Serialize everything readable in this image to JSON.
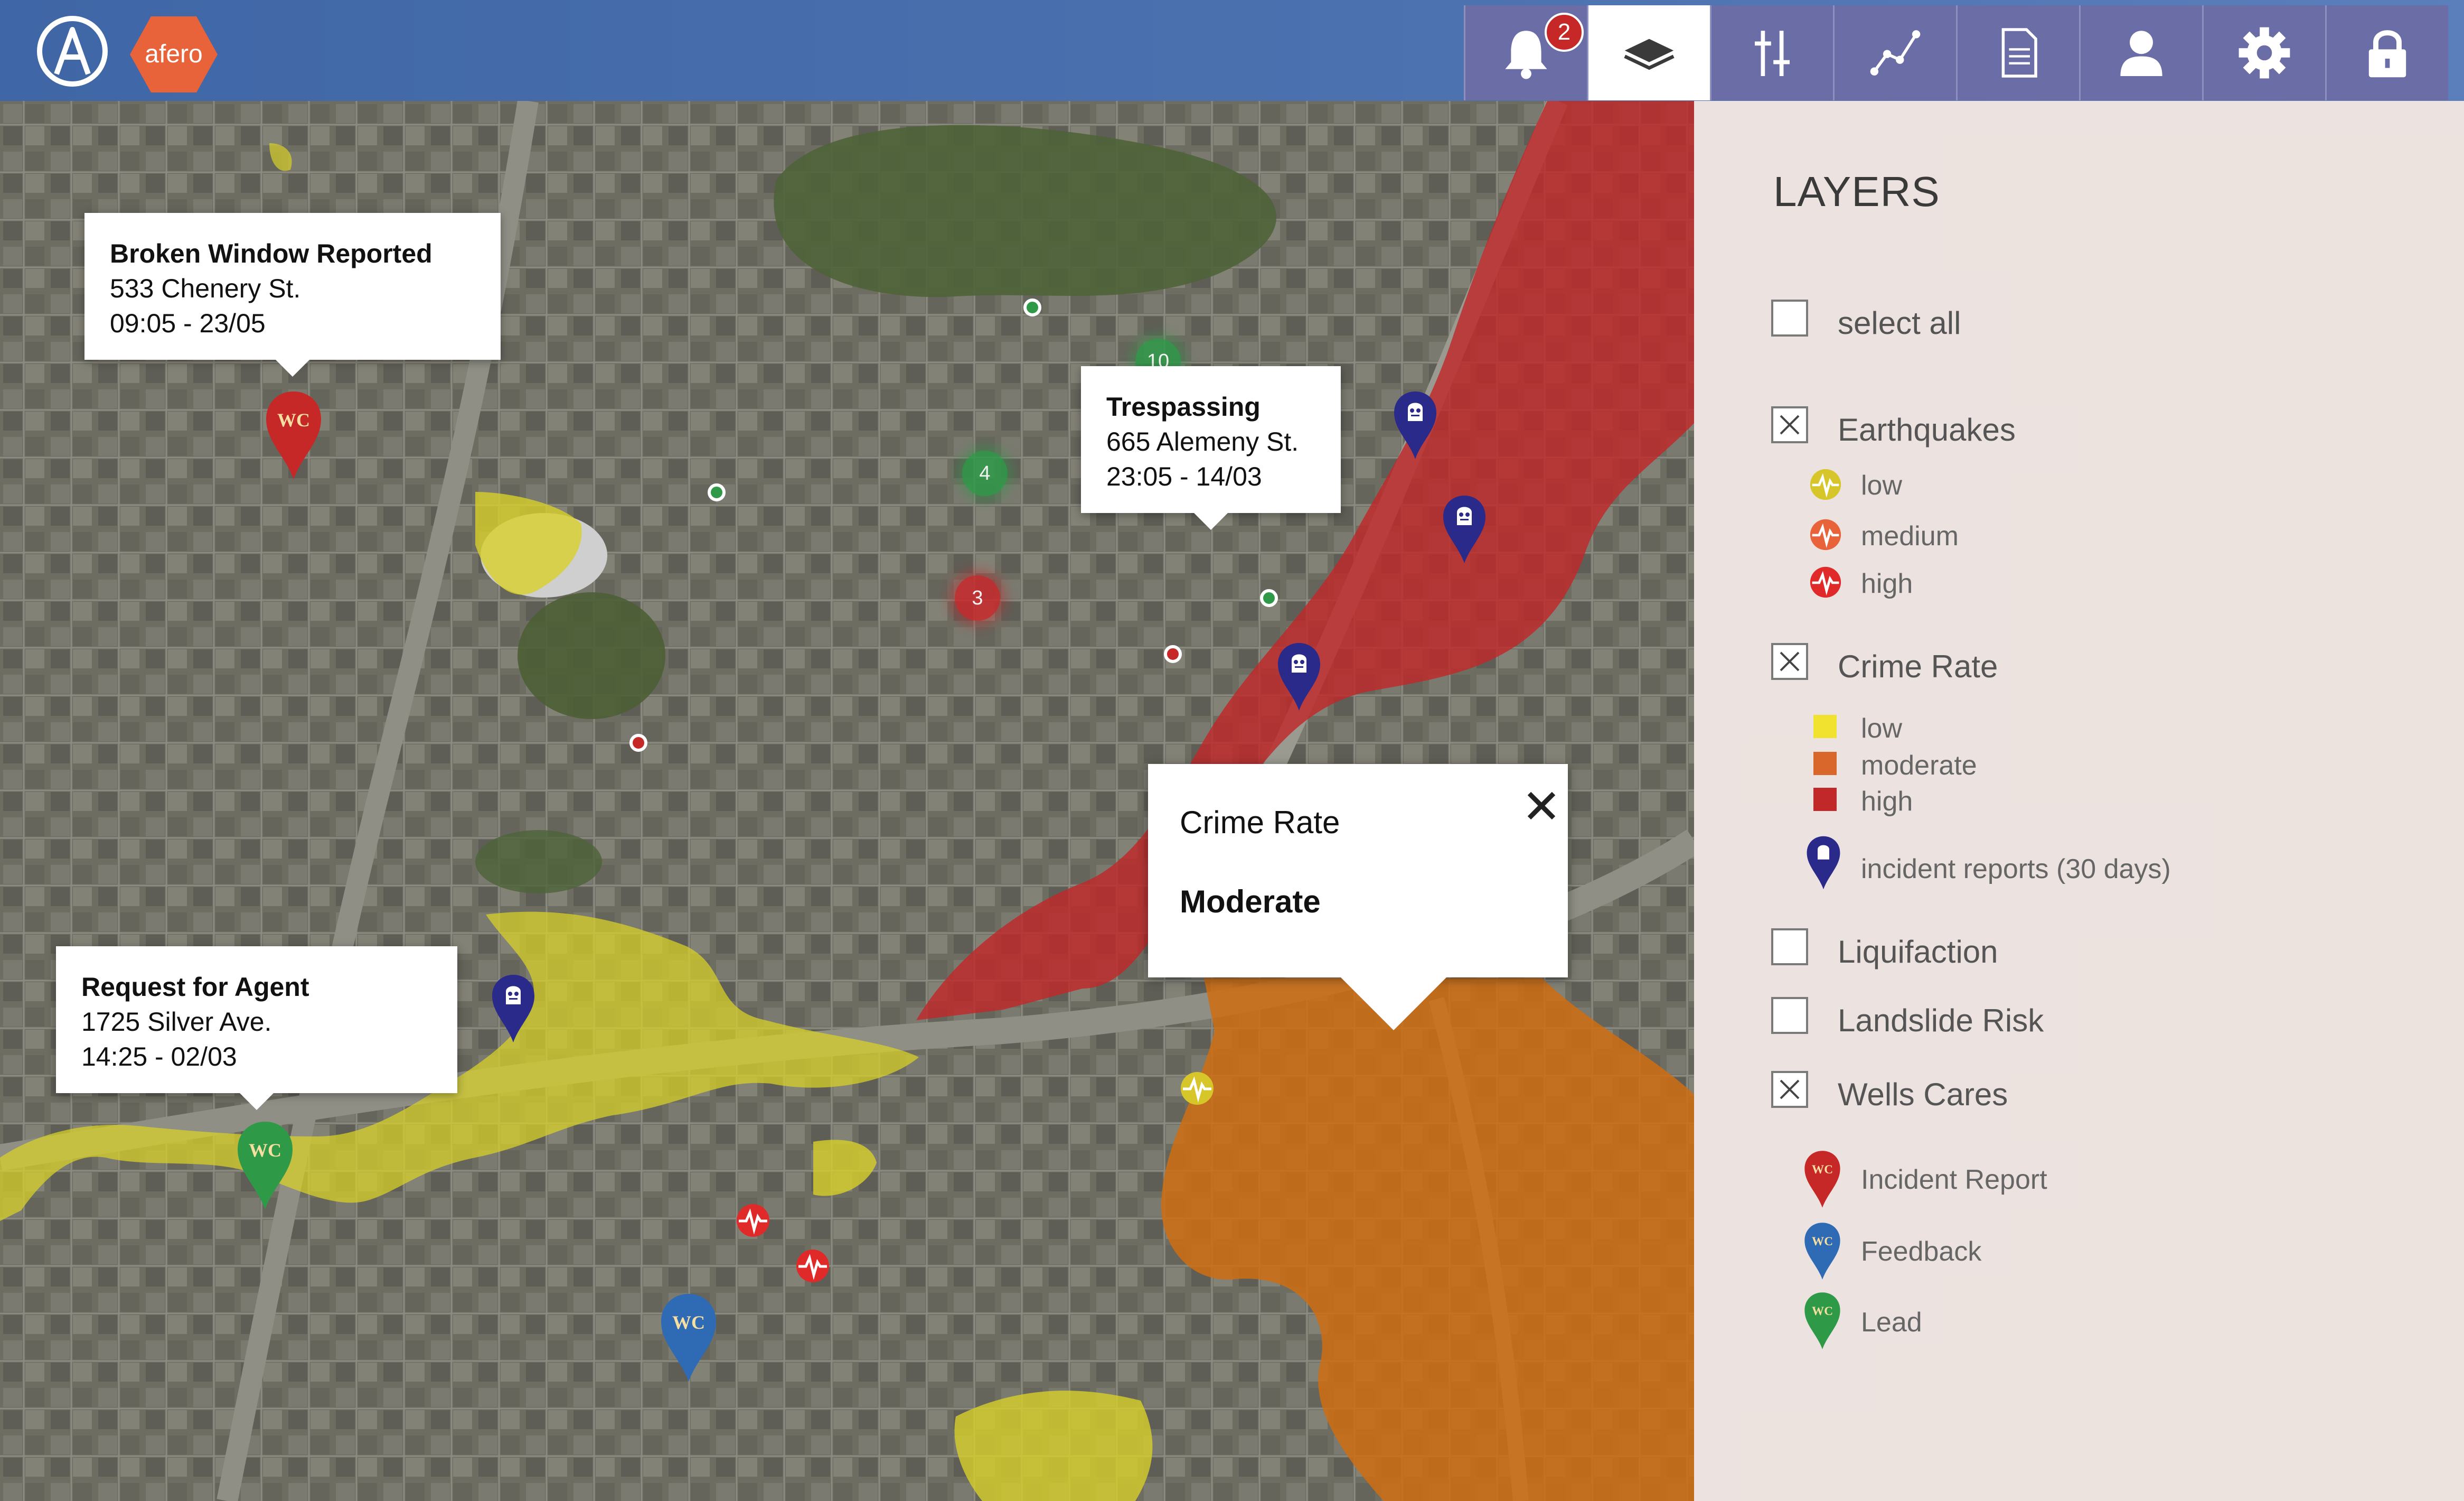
{
  "app": {
    "brand": "afero",
    "brand_color": "#e8623a",
    "header_color": "#4a6fae",
    "toolbar_color": "#6b6da6",
    "notification_count": "2"
  },
  "toolbar": [
    {
      "icon": "bell-icon",
      "active": false
    },
    {
      "icon": "layers-icon",
      "active": true
    },
    {
      "icon": "sliders-icon",
      "active": false
    },
    {
      "icon": "line-chart-icon",
      "active": false
    },
    {
      "icon": "document-icon",
      "active": false
    },
    {
      "icon": "user-icon",
      "active": false
    },
    {
      "icon": "gear-icon",
      "active": false
    },
    {
      "icon": "lock-icon",
      "active": false
    }
  ],
  "callouts": {
    "broken_window": {
      "title": "Broken Window Reported",
      "address": "533 Chenery St.",
      "time": "09:05 - 23/05"
    },
    "trespassing": {
      "title": "Trespassing",
      "address": "665 Alemeny St.",
      "time": "23:05 - 14/03"
    },
    "request_agent": {
      "title": "Request for Agent",
      "address": "1725 Silver Ave.",
      "time": "14:25 - 02/03"
    }
  },
  "popup": {
    "title": "Crime Rate",
    "value": "Moderate"
  },
  "map": {
    "clusters": [
      {
        "count": "10",
        "color": "green"
      },
      {
        "count": "4",
        "color": "green"
      },
      {
        "count": "3",
        "color": "red"
      }
    ],
    "pin_label": "WC"
  },
  "layers": {
    "title": "LAYERS",
    "select_all": {
      "label": "select all",
      "checked": false
    },
    "earthquakes": {
      "label": "Earthquakes",
      "checked": true,
      "levels": [
        {
          "label": "low",
          "color": "#d7c62a"
        },
        {
          "label": "medium",
          "color": "#e8623a"
        },
        {
          "label": "high",
          "color": "#e02a2a"
        }
      ]
    },
    "crime_rate": {
      "label": "Crime Rate",
      "checked": true,
      "levels": [
        {
          "label": "low",
          "color": "#f2e230"
        },
        {
          "label": "moderate",
          "color": "#d9662a"
        },
        {
          "label": "high",
          "color": "#c0282a"
        }
      ],
      "incidents": "incident reports (30 days)"
    },
    "liquifaction": {
      "label": "Liquifaction",
      "checked": false
    },
    "landslide": {
      "label": "Landslide Risk",
      "checked": false
    },
    "wells_cares": {
      "label": "Wells Cares",
      "checked": true,
      "items": [
        {
          "label": "Incident Report",
          "color": "#c62828"
        },
        {
          "label": "Feedback",
          "color": "#2f6ab5"
        },
        {
          "label": "Lead",
          "color": "#2e9a48"
        }
      ]
    }
  }
}
